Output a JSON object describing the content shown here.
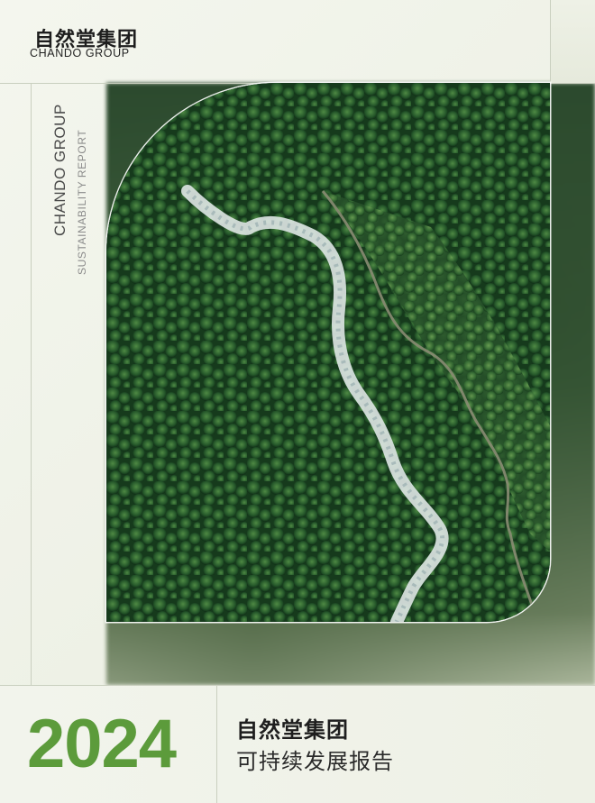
{
  "brand": {
    "name_cn": "自然堂集团",
    "name_en": "CHANDO GROUP"
  },
  "side": {
    "group_label": "CHANDO GROUP",
    "report_label": "SUSTAINABILITY REPORT"
  },
  "cover": {
    "year": "2024",
    "title_line1": "自然堂集团",
    "title_line2": "可持续发展报告"
  },
  "colors": {
    "accent": "#5c9b3b",
    "background": "#eef1e6",
    "rule": "#c9cfbf"
  },
  "image": {
    "subject": "aerial view of a forest river"
  }
}
